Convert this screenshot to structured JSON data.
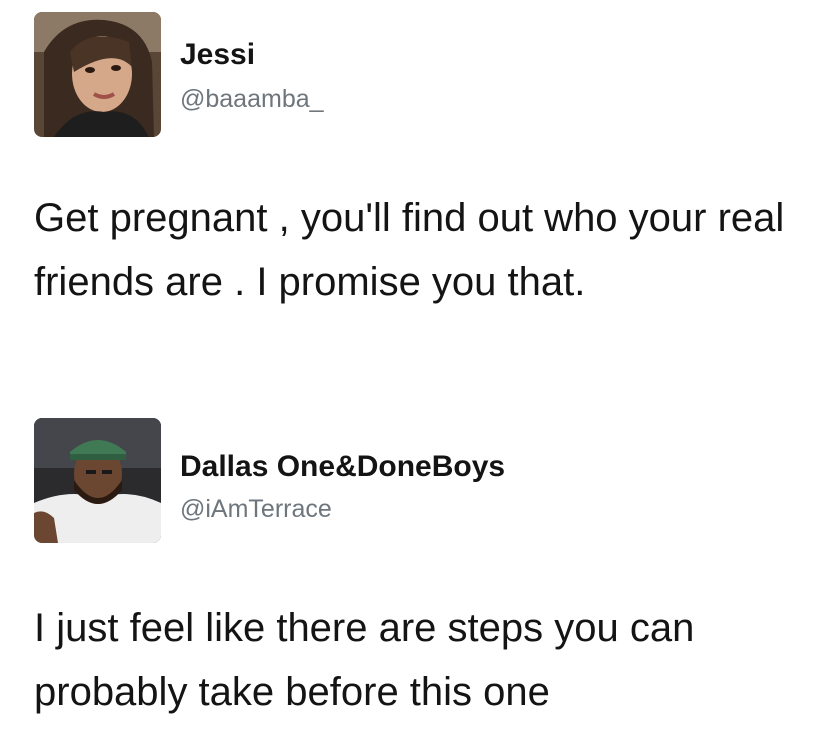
{
  "tweets": [
    {
      "avatar_icon": "profile-photo-woman",
      "display_name": "Jessi",
      "handle": "@baaamba_",
      "text": "Get pregnant , you'll find out who your real friends are . I promise you that."
    },
    {
      "avatar_icon": "profile-photo-man-green-cap",
      "display_name": "Dallas One&DoneBoys",
      "handle": "@iAmTerrace",
      "text": "I just feel like there are steps you can probably take before this one"
    }
  ]
}
